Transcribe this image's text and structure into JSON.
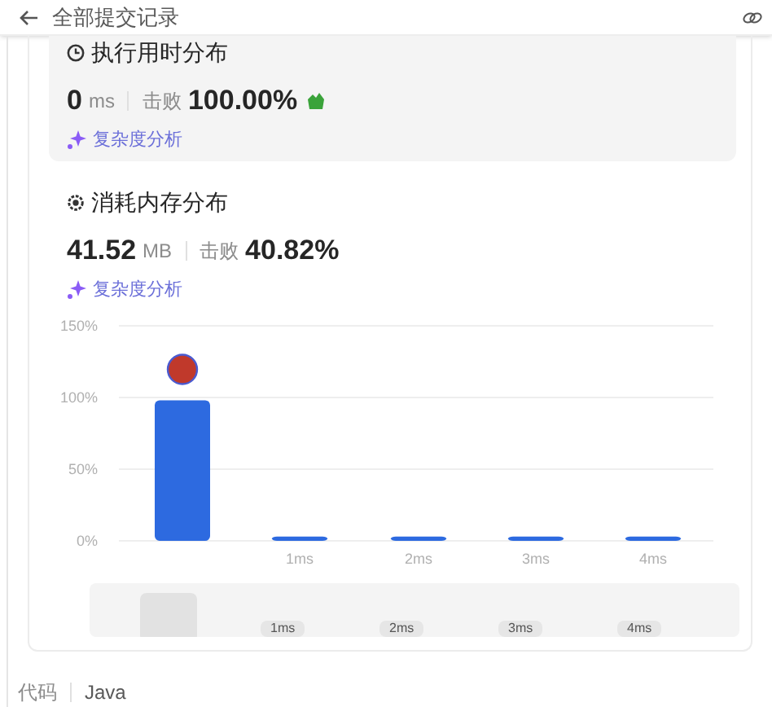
{
  "header": {
    "title": "全部提交记录"
  },
  "runtime": {
    "title": "执行用时分布",
    "value": "0",
    "unit": "ms",
    "beats_label": "击败",
    "beats": "100.00%",
    "analysis": "复杂度分析"
  },
  "memory": {
    "title": "消耗内存分布",
    "value": "41.52",
    "unit": "MB",
    "beats_label": "击败",
    "beats": "40.82%",
    "analysis": "复杂度分析"
  },
  "chart_data": {
    "type": "bar",
    "categories": [
      null,
      "1ms",
      "2ms",
      "3ms",
      "4ms"
    ],
    "values": [
      98,
      3,
      3,
      3,
      3
    ],
    "ylim": [
      0,
      150
    ],
    "yticks": [
      {
        "value": 0,
        "label": "0%"
      },
      {
        "value": 50,
        "label": "50%"
      },
      {
        "value": 100,
        "label": "100%"
      },
      {
        "value": 150,
        "label": "150%"
      }
    ]
  },
  "brush": {
    "labels": [
      "1ms",
      "2ms",
      "3ms",
      "4ms"
    ]
  },
  "footer": {
    "label": "代码",
    "language": "Java"
  }
}
